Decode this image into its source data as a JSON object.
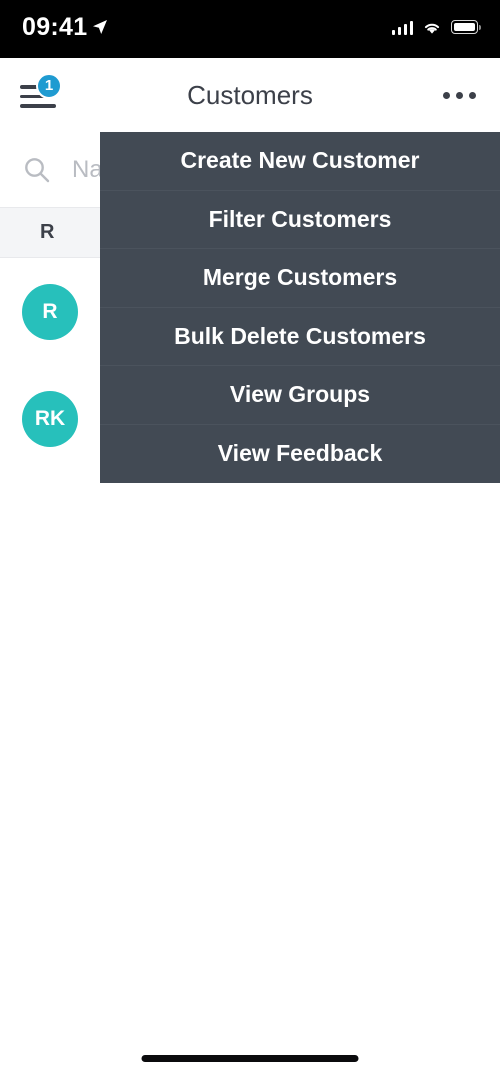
{
  "status_bar": {
    "time": "09:41",
    "location_icon": "location-arrow-icon",
    "signal_icon": "cellular-signal-icon",
    "wifi_icon": "wifi-icon",
    "battery_icon": "battery-full-icon"
  },
  "navbar": {
    "menu_icon": "hamburger-menu-icon",
    "badge_count": "1",
    "title": "Customers",
    "more_icon": "more-options-icon"
  },
  "search": {
    "icon": "search-icon",
    "value": "",
    "placeholder": "Name"
  },
  "list": {
    "section_header": "R",
    "items": [
      {
        "initials": "R",
        "name": "",
        "subtitle": ""
      },
      {
        "initials": "RK",
        "name": "",
        "subtitle": ""
      }
    ]
  },
  "dropdown_menu": {
    "items": [
      {
        "label": "Create New Customer"
      },
      {
        "label": "Filter Customers"
      },
      {
        "label": "Merge Customers"
      },
      {
        "label": "Bulk Delete Customers"
      },
      {
        "label": "View Groups"
      },
      {
        "label": "View Feedback"
      }
    ]
  },
  "home_indicator": "home-indicator",
  "colors": {
    "menu_background": "#424a54",
    "avatar": "#27c0bb",
    "badge": "#1f9bd1",
    "text_primary": "#3c4049",
    "section_background": "#f4f5f7"
  }
}
